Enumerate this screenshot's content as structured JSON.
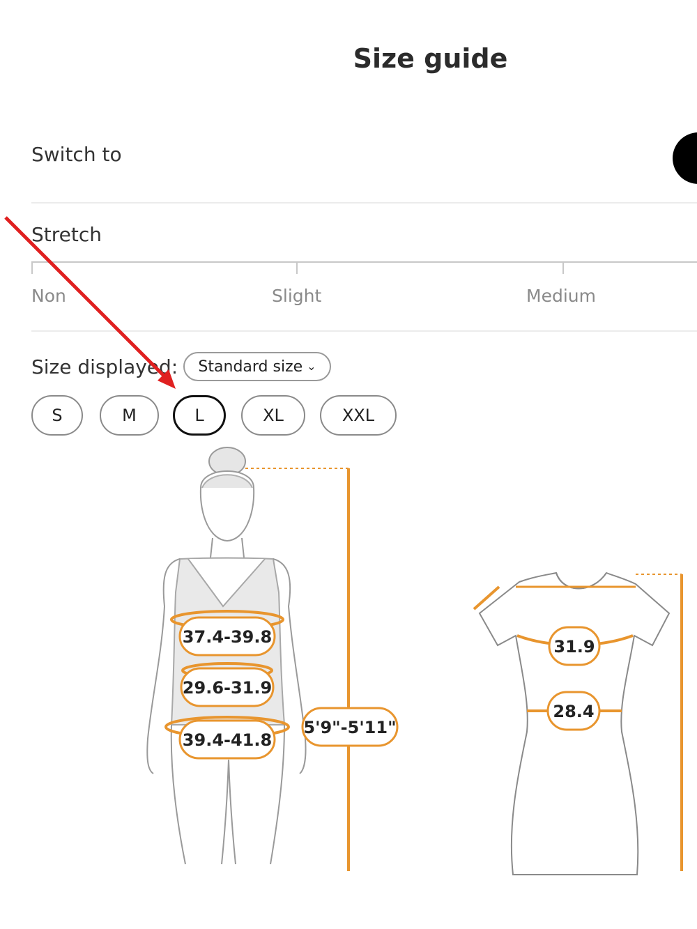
{
  "header": {
    "title": "Size guide"
  },
  "switch": {
    "label": "Switch to"
  },
  "stretch": {
    "label": "Stretch",
    "levels": [
      "Non",
      "Slight",
      "Medium"
    ]
  },
  "size_display": {
    "label": "Size displayed:",
    "selector_value": "Standard size"
  },
  "sizes": {
    "options": [
      "S",
      "M",
      "L",
      "XL",
      "XXL"
    ],
    "selected": "L"
  },
  "body_measurements": {
    "bust": "37.4-39.8",
    "waist": "29.6-31.9",
    "hips": "39.4-41.8",
    "height": "5'9\"-5'11\""
  },
  "garment_measurements": {
    "bust": "31.9",
    "waist": "28.4"
  },
  "colors": {
    "accent": "#e8952e",
    "annotation_arrow": "#e02020",
    "selected_border": "#111111"
  },
  "icons": {
    "selector_chevron": "chevron-down-icon"
  }
}
